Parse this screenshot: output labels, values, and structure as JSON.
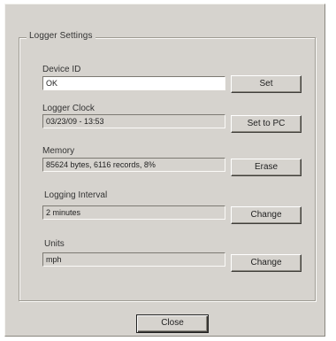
{
  "group": {
    "title": "Logger Settings"
  },
  "device_id": {
    "label": "Device ID",
    "value": "OK",
    "button": "Set"
  },
  "logger_clock": {
    "label": "Logger Clock",
    "value": "03/23/09 - 13:53",
    "button": "Set to PC"
  },
  "memory": {
    "label": "Memory",
    "value": "85624 bytes, 6116 records, 8%",
    "button": "Erase"
  },
  "logging_interval": {
    "label": "Logging Interval",
    "value": "2 minutes",
    "button": "Change"
  },
  "units": {
    "label": "Units",
    "value": "mph",
    "button": "Change"
  },
  "footer": {
    "close_label": "Close"
  }
}
